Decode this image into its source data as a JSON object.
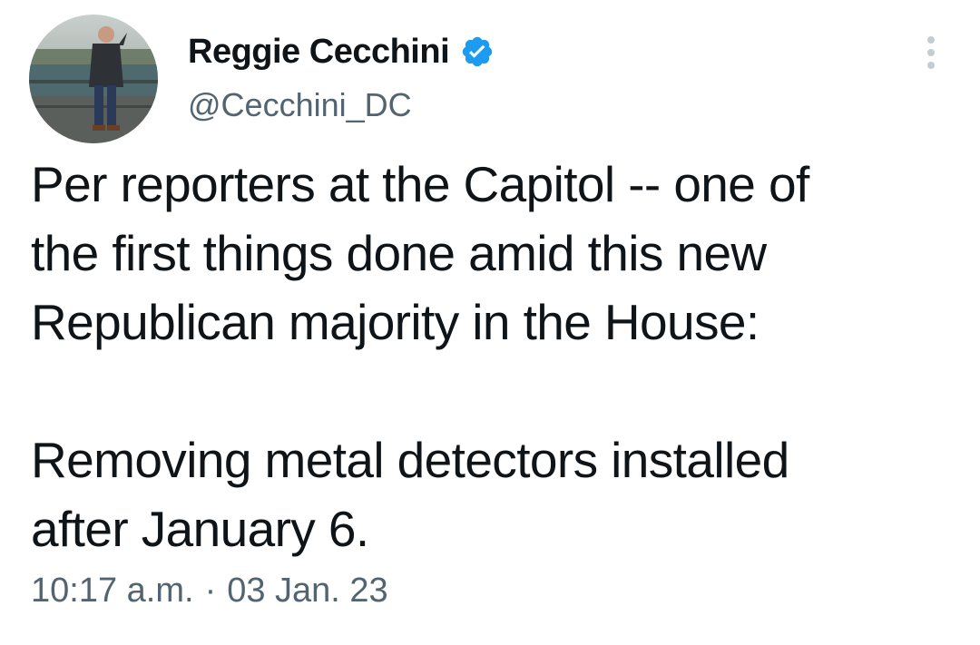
{
  "author": {
    "display_name": "Reggie Cecchini",
    "handle": "@Cecchini_DC",
    "verified": true,
    "avatar_icon": "profile-photo"
  },
  "tweet": {
    "lines": [
      "Per reporters at the Capitol -- one of",
      "the first things done amid this new",
      "Republican majority in the House:",
      "",
      "Removing metal detectors installed",
      "after January 6."
    ],
    "time": "10:17 a.m.",
    "separator": "·",
    "date": "03 Jan. 23"
  },
  "icons": {
    "verified": "verified-badge-icon",
    "more": "more-options-icon"
  },
  "colors": {
    "verified_blue": "#1d9bf0",
    "text_primary": "#0f1419",
    "text_secondary": "#536471"
  }
}
